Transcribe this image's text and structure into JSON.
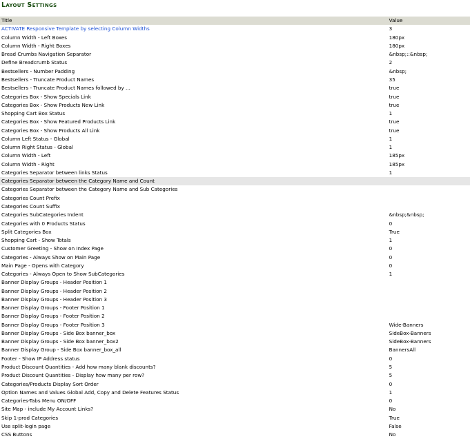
{
  "page": {
    "title": "Layout Settings"
  },
  "colors": {
    "title_green": "#1a4d12",
    "header_bg": "#dcdcd2",
    "selected_row_bg": "#e6e6e6",
    "link_blue": "#1b4fd6"
  },
  "table": {
    "headers": {
      "title": "Title",
      "value": "Value"
    },
    "rows": [
      {
        "title": "ACTIVATE Responsive Template by selecting Column Widths",
        "value": "3"
      },
      {
        "title": "Column Width - Left Boxes",
        "value": "180px"
      },
      {
        "title": "Column Width - Right Boxes",
        "value": "180px"
      },
      {
        "title": "Bread Crumbs Navigation Separator",
        "value": "&nbsp;::&nbsp;"
      },
      {
        "title": "Define Breadcrumb Status",
        "value": "2"
      },
      {
        "title": "Bestsellers - Number Padding",
        "value": "&nbsp;"
      },
      {
        "title": "Bestsellers - Truncate Product Names",
        "value": "35"
      },
      {
        "title": "Bestsellers - Truncate Product Names followed by ...",
        "value": "true"
      },
      {
        "title": "Categories Box - Show Specials Link",
        "value": "true"
      },
      {
        "title": "Categories Box - Show Products New Link",
        "value": "true"
      },
      {
        "title": "Shopping Cart Box Status",
        "value": "1"
      },
      {
        "title": "Categories Box - Show Featured Products Link",
        "value": "true"
      },
      {
        "title": "Categories Box - Show Products All Link",
        "value": "true"
      },
      {
        "title": "Column Left Status - Global",
        "value": "1"
      },
      {
        "title": "Column Right Status - Global",
        "value": "1"
      },
      {
        "title": "Column Width - Left",
        "value": "185px"
      },
      {
        "title": "Column Width - Right",
        "value": "185px"
      },
      {
        "title": "Categories Separator between links Status",
        "value": "1"
      },
      {
        "title": "Categories Separator between the Category Name and Count",
        "value": ""
      },
      {
        "title": "Categories Separator between the Category Name and Sub Categories",
        "value": ""
      },
      {
        "title": "Categories Count Prefix",
        "value": ""
      },
      {
        "title": "Categories Count Suffix",
        "value": ""
      },
      {
        "title": "Categories SubCategories Indent",
        "value": "&nbsp;&nbsp;"
      },
      {
        "title": "Categories with 0 Products Status",
        "value": "0"
      },
      {
        "title": "Split Categories Box",
        "value": "True"
      },
      {
        "title": "Shopping Cart - Show Totals",
        "value": "1"
      },
      {
        "title": "Customer Greeting - Show on Index Page",
        "value": "0"
      },
      {
        "title": "Categories - Always Show on Main Page",
        "value": "0"
      },
      {
        "title": "Main Page - Opens with Category",
        "value": "0"
      },
      {
        "title": "Categories - Always Open to Show SubCategories",
        "value": "1"
      },
      {
        "title": "Banner Display Groups - Header Position 1",
        "value": ""
      },
      {
        "title": "Banner Display Groups - Header Position 2",
        "value": ""
      },
      {
        "title": "Banner Display Groups - Header Position 3",
        "value": ""
      },
      {
        "title": "Banner Display Groups - Footer Position 1",
        "value": ""
      },
      {
        "title": "Banner Display Groups - Footer Position 2",
        "value": ""
      },
      {
        "title": "Banner Display Groups - Footer Position 3",
        "value": "Wide-Banners"
      },
      {
        "title": "Banner Display Groups - Side Box banner_box",
        "value": "SideBox-Banners"
      },
      {
        "title": "Banner Display Groups - Side Box banner_box2",
        "value": "SideBox-Banners"
      },
      {
        "title": "Banner Display Group - Side Box banner_box_all",
        "value": "BannersAll"
      },
      {
        "title": "Footer - Show IP Address status",
        "value": "0"
      },
      {
        "title": "Product Discount Quantities - Add how many blank discounts?",
        "value": "5"
      },
      {
        "title": "Product Discount Quantities - Display how many per row?",
        "value": "5"
      },
      {
        "title": "Categories/Products Display Sort Order",
        "value": "0"
      },
      {
        "title": "Option Names and Values Global Add, Copy and Delete Features Status",
        "value": "1"
      },
      {
        "title": "Categories-Tabs Menu ON/OFF",
        "value": "0"
      },
      {
        "title": "Site Map - include My Account Links?",
        "value": "No"
      },
      {
        "title": "Skip 1-prod Categories",
        "value": "True"
      },
      {
        "title": "Use split-login page",
        "value": "False"
      },
      {
        "title": "CSS Buttons",
        "value": "No"
      }
    ]
  }
}
